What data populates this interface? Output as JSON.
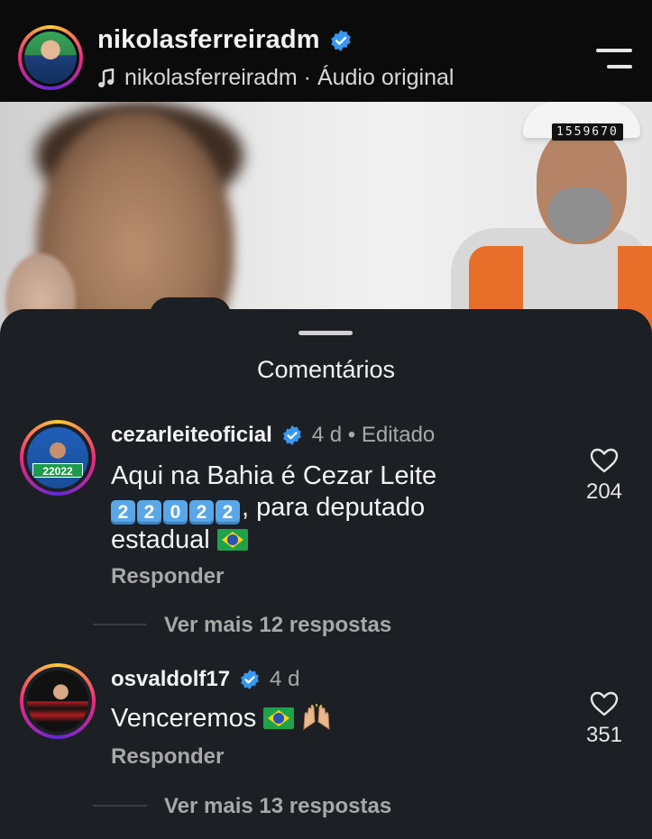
{
  "header": {
    "username": "nikolasferreiradm",
    "audio_text": "nikolasferreiradm · Áudio original"
  },
  "video": {
    "counter_text": "1559670"
  },
  "comments_sheet": {
    "title": "Comentários",
    "comments": [
      {
        "username": "cezarleiteoficial",
        "meta": "4 d • Editado",
        "avatar_badge": "22022",
        "text_part1": "Aqui na Bahia é Cezar Leite",
        "keycaps": [
          "2",
          "2",
          "0",
          "2",
          "2"
        ],
        "text_part2": ", para deputado",
        "text_part3": "estadual",
        "reply_label": "Responder",
        "likes": "204",
        "more_replies": "Ver mais 12 respostas"
      },
      {
        "username": "osvaldolf17",
        "meta": "4 d",
        "text": "Venceremos",
        "reply_label": "Responder",
        "likes": "351",
        "more_replies": "Ver mais 13 respostas"
      }
    ]
  },
  "colors": {
    "sheet_bg": "#1c1f24",
    "verified_blue": "#3897f0",
    "secondary_text": "#a8a8a8"
  }
}
